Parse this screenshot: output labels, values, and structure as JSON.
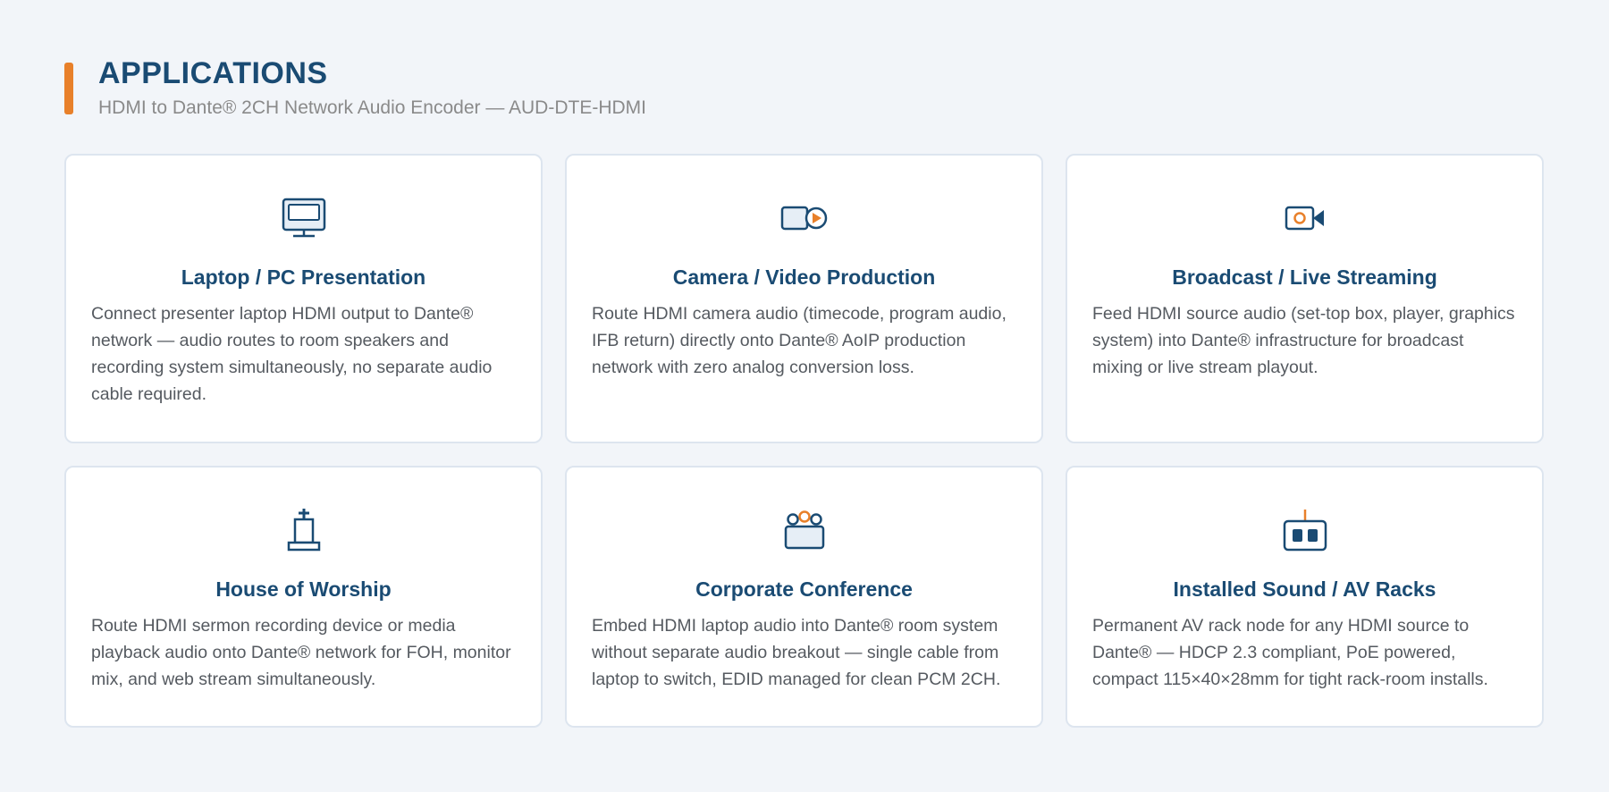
{
  "header": {
    "title": "APPLICATIONS",
    "subtitle": "HDMI to Dante® 2CH Network Audio Encoder — AUD-DTE-HDMI"
  },
  "colors": {
    "accent": "#e8802a",
    "primary": "#1a4b73",
    "background": "#f2f5f9"
  },
  "cards": [
    {
      "icon": "monitor-icon",
      "title": "Laptop / PC Presentation",
      "description": "Connect presenter laptop HDMI output to Dante® network — audio routes to room speakers and recording system simultaneously, no separate audio cable required."
    },
    {
      "icon": "video-camera-play-icon",
      "title": "Camera / Video Production",
      "description": "Route HDMI camera audio (timecode, program audio, IFB return) directly onto Dante® AoIP production network with zero analog conversion loss."
    },
    {
      "icon": "broadcast-camera-icon",
      "title": "Broadcast / Live Streaming",
      "description": "Feed HDMI source audio (set-top box, player, graphics system) into Dante® infrastructure for broadcast mixing or live stream playout."
    },
    {
      "icon": "church-cross-icon",
      "title": "House of Worship",
      "description": "Route HDMI sermon recording device or media playback audio onto Dante® network for FOH, monitor mix, and web stream simultaneously."
    },
    {
      "icon": "conference-table-icon",
      "title": "Corporate Conference",
      "description": "Embed HDMI laptop audio into Dante® room system without separate audio breakout — single cable from laptop to switch, EDID managed for clean PCM 2CH."
    },
    {
      "icon": "av-rack-device-icon",
      "title": "Installed Sound / AV Racks",
      "description": "Permanent AV rack node for any HDMI source to Dante® — HDCP 2.3 compliant, PoE powered, compact 115×40×28mm for tight rack-room installs."
    }
  ]
}
